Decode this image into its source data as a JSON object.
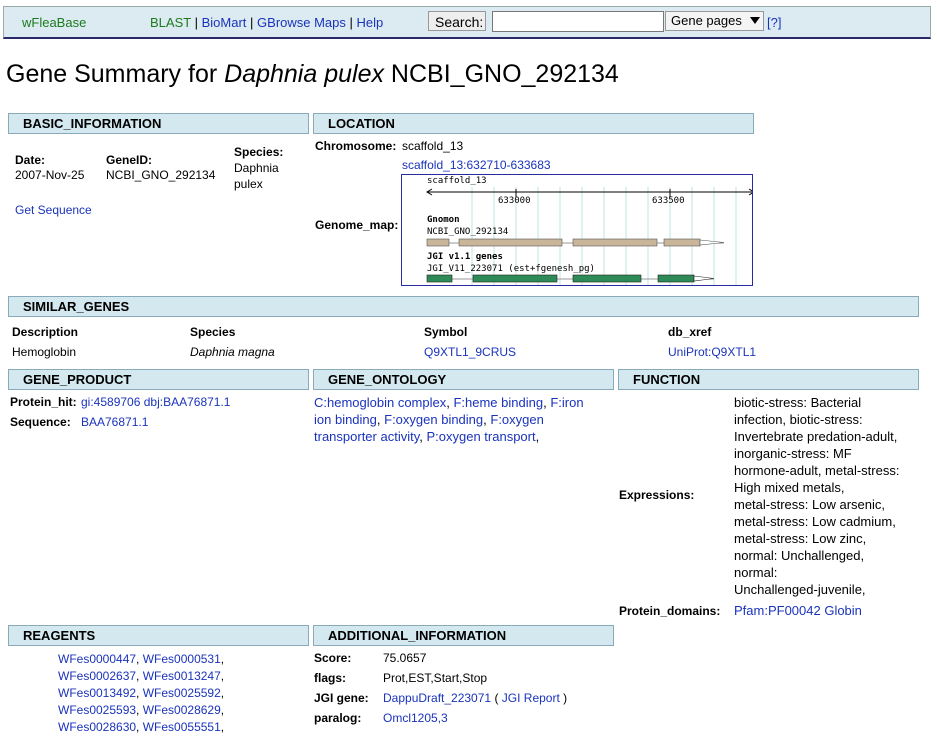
{
  "nav": {
    "brand": "wFleaBase",
    "links": [
      "BLAST",
      "BioMart",
      "GBrowse Maps",
      "Help"
    ],
    "separator": "|",
    "search_label": "Search:",
    "search_value": "",
    "select_value": "Gene pages",
    "help_link": "[?]"
  },
  "title": {
    "prefix": "Gene Summary for ",
    "species": "Daphnia pulex",
    "gene": " NCBI_GNO_292134"
  },
  "basic": {
    "header": "BASIC_INFORMATION",
    "date_label": "Date:",
    "date": "2007-Nov-25",
    "geneid_label": "GeneID:",
    "geneid": "NCBI_GNO_292134",
    "species_label": "Species:",
    "species_line1": "Daphnia",
    "species_line2": "pulex",
    "get_sequence": "Get Sequence"
  },
  "location": {
    "header": "LOCATION",
    "chromosome_label": "Chromosome:",
    "chromosome": "scaffold_13",
    "link": "scaffold_13:632710-633683",
    "genome_map_label": "Genome_map:"
  },
  "genome_map": {
    "scaffold": "scaffold_13",
    "ticks": [
      "633000",
      "633500"
    ],
    "track1_title": "Gnomon",
    "track1_name": "NCBI_GNO_292134",
    "track2_title": "JGI v1.1 genes",
    "track2_name": "JGI_V11_223071 (est+fgenesh_pg)"
  },
  "similar": {
    "header": "SIMILAR_GENES",
    "columns": [
      "Description",
      "Species",
      "Symbol",
      "db_xref"
    ],
    "row": {
      "description": "Hemoglobin",
      "species": "Daphnia magna",
      "symbol": "Q9XTL1_9CRUS",
      "xref": "UniProt:Q9XTL1"
    }
  },
  "gene_product": {
    "header": "GENE_PRODUCT",
    "protein_hit_label": "Protein_hit:",
    "protein_hit_1": "gi:4589706",
    "protein_hit_2": "dbj:BAA76871.1",
    "sequence_label": "Sequence:",
    "sequence": "BAA76871.1"
  },
  "gene_ontology": {
    "header": "GENE_ONTOLOGY",
    "lines": [
      [
        "C:hemoglobin complex",
        ", ",
        "F:heme binding",
        ", ",
        "F:iron"
      ],
      [
        "ion binding",
        ", ",
        "F:oxygen binding",
        ", ",
        "F:oxygen"
      ],
      [
        "transporter activity",
        ", ",
        "P:oxygen transport",
        ","
      ]
    ]
  },
  "function": {
    "header": "FUNCTION",
    "expressions_label": "Expressions:",
    "expressions": [
      "biotic-stress: Bacterial",
      "infection, biotic-stress:",
      "Invertebrate predation-adult,",
      "inorganic-stress: MF",
      "hormone-adult, metal-stress:",
      "High mixed metals,",
      "metal-stress: Low arsenic,",
      "metal-stress: Low cadmium,",
      "metal-stress: Low zinc,",
      "normal: Unchallenged,",
      "normal:",
      "Unchallenged-juvenile,"
    ],
    "protein_domains_label": "Protein_domains:",
    "protein_domains": "Pfam:PF00042 Globin"
  },
  "reagents": {
    "header": "REAGENTS",
    "rows": [
      [
        "WFes0000447",
        "WFes0000531"
      ],
      [
        "WFes0002637",
        "WFes0013247"
      ],
      [
        "WFes0013492",
        "WFes0025592"
      ],
      [
        "WFes0025593",
        "WFes0028629"
      ],
      [
        "WFes0028630",
        "WFes0055551"
      ]
    ]
  },
  "additional": {
    "header": "ADDITIONAL_INFORMATION",
    "score_label": "Score:",
    "score": "75.0657",
    "flags_label": "flags:",
    "flags": "Prot,EST,Start,Stop",
    "jgi_label": "JGI gene:",
    "jgi_gene": "DappuDraft_223071",
    "jgi_open": "(",
    "jgi_report": "JGI Report",
    "jgi_close": ")",
    "paralog_label": "paralog:",
    "paralog": "Omcl1205,3"
  }
}
